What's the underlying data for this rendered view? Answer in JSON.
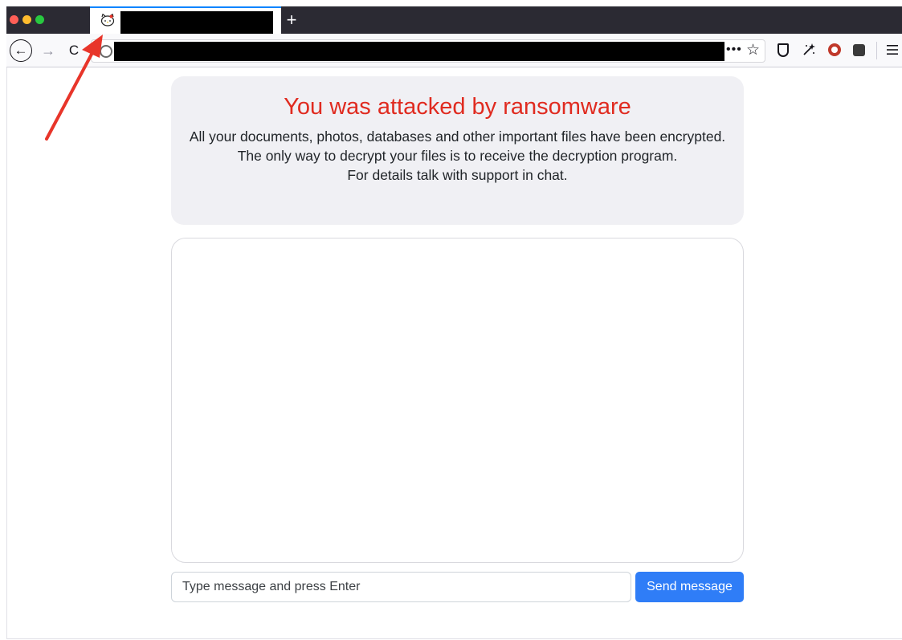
{
  "browser": {
    "tab": {
      "favicon": "hello-kitty-favicon",
      "title": "",
      "title_redacted": true
    },
    "new_tab_label": "+",
    "nav": {
      "back_icon": "←",
      "forward_icon": "→",
      "reload_icon": "C"
    },
    "url": {
      "value": "",
      "redacted": true,
      "page_actions": "•••",
      "bookmark_icon": "☆"
    },
    "toolbar_icons": [
      "shield-icon",
      "magic-wand-icon",
      "ublock-icon",
      "extension-icon",
      "menu-icon"
    ]
  },
  "page": {
    "notice": {
      "title": "You was attacked by ransomware",
      "line1": "All your documents, photos, databases and other important files have been encrypted.",
      "line2": "The only way to decrypt your files is to receive the decryption program.",
      "line3": "For details talk with support in chat."
    },
    "chat": {
      "input_placeholder": "Type message and press Enter",
      "send_label": "Send message"
    }
  },
  "colors": {
    "title_red": "#e02b20",
    "send_blue": "#2f7df7",
    "annotation_arrow": "#e8352a"
  }
}
